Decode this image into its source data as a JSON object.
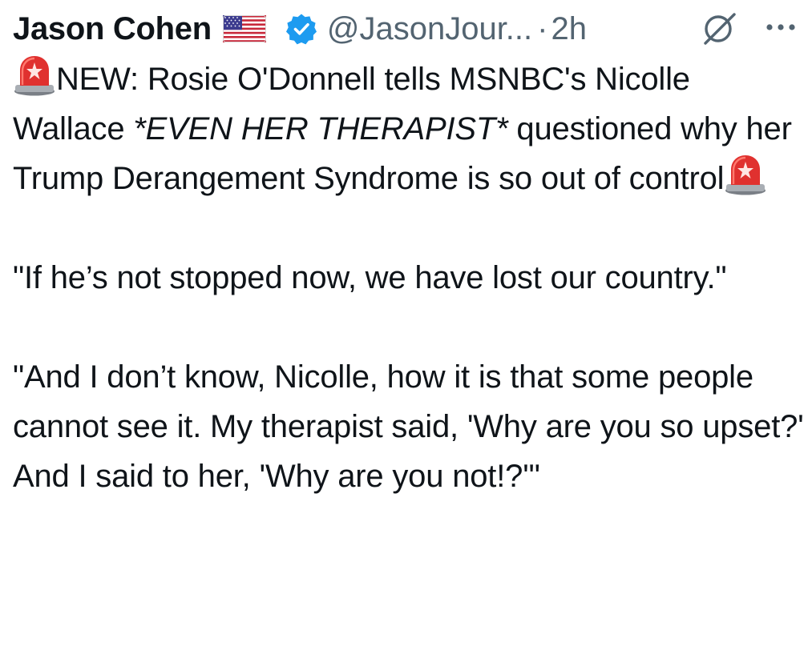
{
  "tweet": {
    "display_name": "Jason Cohen",
    "flag_icon": "us-flag-icon",
    "verified_icon": "verified-badge-icon",
    "handle": "@JasonJour...",
    "separator": "·",
    "time": "2h",
    "grok_icon": "grok-icon",
    "more_icon": "more-options-icon",
    "colors": {
      "text": "#0f1419",
      "muted": "#536471",
      "verified": "#1d9bf0",
      "siren_red": "#e0312f"
    },
    "body": {
      "p1_siren_icon": "police-siren-icon",
      "p1_text_a": "NEW: Rosie O'Donnell tells MSNBC's Nicolle Wallace ",
      "p1_italic": "*EVEN HER THERAPIST*",
      "p1_text_b": " questioned why her Trump Derangement Syndrome is so out of control",
      "p2_text": "\"If he’s not stopped now, we have lost our country.\"",
      "p3_text": "\"And I don’t know, Nicolle, how it is that some people cannot see it. My therapist said, 'Why are you so upset?' And I said to her, 'Why are you not!?'\""
    }
  }
}
